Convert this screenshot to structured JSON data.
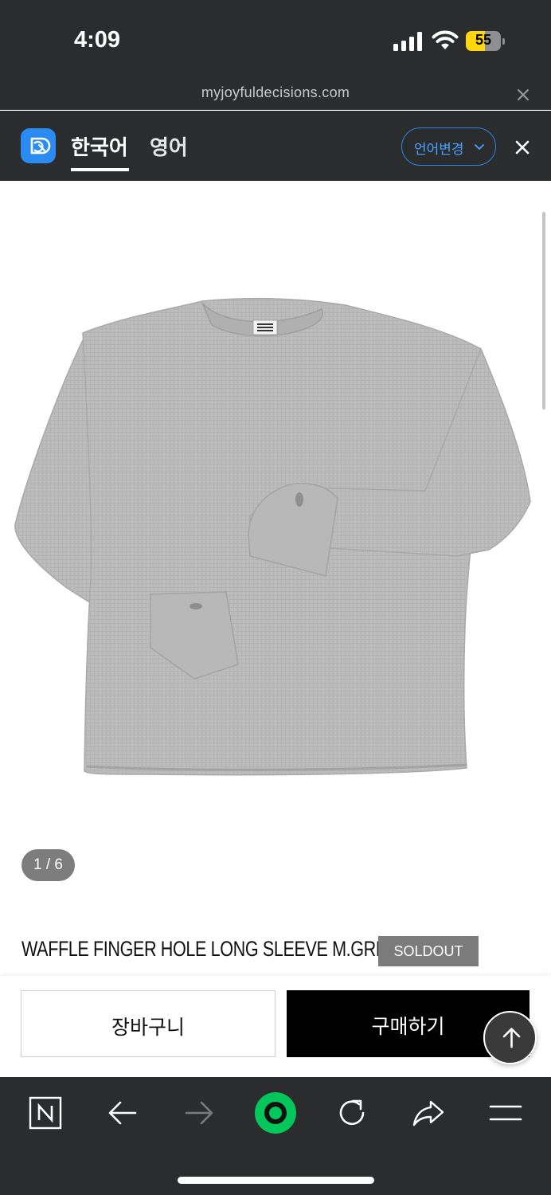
{
  "status_bar": {
    "time": "4:09",
    "battery_level": "55",
    "battery_fraction": 0.55,
    "battery_color": "#ffd60a"
  },
  "url_bar": {
    "url": "myjoyfuldecisions.com"
  },
  "translate_bar": {
    "tabs": [
      {
        "label": "한국어",
        "selected": true
      },
      {
        "label": "영어",
        "selected": false
      }
    ],
    "change_language_label": "언어변경",
    "accent_color": "#2b86e8"
  },
  "product": {
    "image_pager": "1 / 6",
    "title": "WAFFLE FINGER HOLE LONG SLEEVE M.GREY",
    "badge": "SOLDOUT",
    "image_icon": "grey-waffle-long-sleeve-shirt"
  },
  "actions": {
    "cart_label": "장바구니",
    "buy_label": "구매하기"
  },
  "toolbar": {
    "items": [
      {
        "icon": "naver-n-icon"
      },
      {
        "icon": "back-arrow-icon"
      },
      {
        "icon": "forward-arrow-icon"
      },
      {
        "icon": "green-home-icon"
      },
      {
        "icon": "reload-icon"
      },
      {
        "icon": "share-icon"
      },
      {
        "icon": "menu-icon"
      }
    ],
    "home_color": "#03c75a"
  }
}
